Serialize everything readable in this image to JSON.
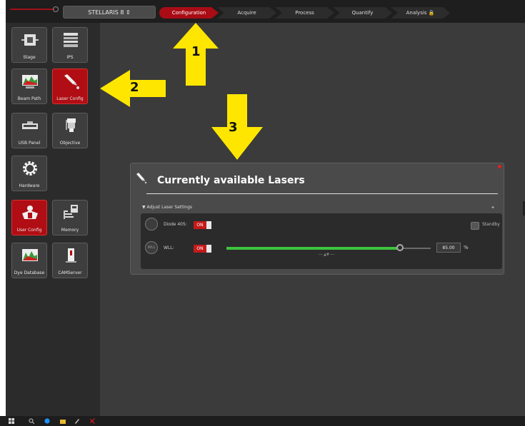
{
  "header": {
    "system_selector": "STELLARIS 8 ⇕",
    "steps": [
      {
        "label": "Configuration",
        "active": true
      },
      {
        "label": "Acquire",
        "active": false
      },
      {
        "label": "Process",
        "active": false
      },
      {
        "label": "Quantify",
        "active": false
      },
      {
        "label": "Analysis 🔒",
        "active": false
      }
    ]
  },
  "sidebar": {
    "tiles": [
      {
        "label": "Stage",
        "icon": "stage-icon"
      },
      {
        "label": "IPS",
        "icon": "ips-icon"
      },
      {
        "label": "Beam Path",
        "icon": "beam-path-icon"
      },
      {
        "label": "Laser Config",
        "icon": "laser-pen-icon",
        "selected": true
      },
      {
        "label": "USB Panel",
        "icon": "usb-panel-icon"
      },
      {
        "label": "Objective",
        "icon": "objective-icon"
      },
      {
        "label": "Hardware",
        "icon": "gear-icon"
      },
      {
        "label": "User Config",
        "icon": "user-config-icon",
        "selected": true
      },
      {
        "label": "Memory",
        "icon": "memory-icon"
      },
      {
        "label": "Dye Database",
        "icon": "dye-database-icon"
      },
      {
        "label": "CAMServer",
        "icon": "camserver-icon"
      }
    ]
  },
  "panel": {
    "title": "Currently available Lasers",
    "section_label": "▼  Adjust Laser Settings",
    "pin_glyph": "✦",
    "lasers": [
      {
        "name": "Diode 405:",
        "toggle": "ON",
        "standby_label": "Standby",
        "power_icon_text": ""
      },
      {
        "name": "WLL:",
        "toggle": "ON",
        "power_value": "85.00",
        "power_unit": "%",
        "power_fraction": 0.85,
        "power_icon_text": "WLL"
      }
    ],
    "fine_handle": "── ▲▼ ──"
  },
  "annotations": [
    {
      "number": "1",
      "direction": "up",
      "color": "#ffe600"
    },
    {
      "number": "2",
      "direction": "left",
      "color": "#ffe600"
    },
    {
      "number": "3",
      "direction": "down",
      "color": "#ffe600"
    }
  ],
  "colors": {
    "accent_red": "#b00e14",
    "laser_green": "#3ec43e",
    "arrow_yellow": "#ffe600"
  }
}
